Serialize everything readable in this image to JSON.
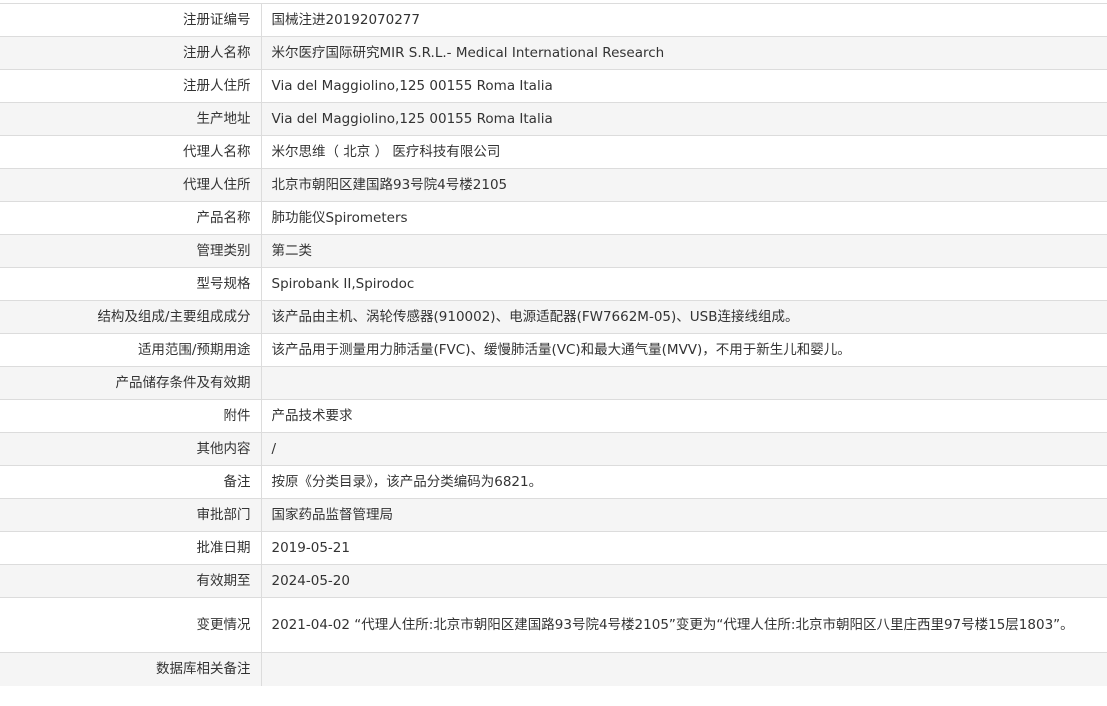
{
  "rows": [
    {
      "label": "注册证编号",
      "value": "国械注进20192070277"
    },
    {
      "label": "注册人名称",
      "value": "米尔医疗国际研究MIR S.R.L.- Medical International Research"
    },
    {
      "label": "注册人住所",
      "value": "Via del Maggiolino,125 00155 Roma Italia"
    },
    {
      "label": "生产地址",
      "value": "Via del Maggiolino,125 00155 Roma Italia"
    },
    {
      "label": "代理人名称",
      "value": "米尔思维（ 北京 ） 医疗科技有限公司"
    },
    {
      "label": "代理人住所",
      "value": "北京市朝阳区建国路93号院4号楼2105"
    },
    {
      "label": "产品名称",
      "value": "肺功能仪Spirometers"
    },
    {
      "label": "管理类别",
      "value": "第二类"
    },
    {
      "label": "型号规格",
      "value": "Spirobank II,Spirodoc"
    },
    {
      "label": "结构及组成/主要组成成分",
      "value": "该产品由主机、涡轮传感器(910002)、电源适配器(FW7662M-05)、USB连接线组成。"
    },
    {
      "label": "适用范围/预期用途",
      "value": "该产品用于测量用力肺活量(FVC)、缓慢肺活量(VC)和最大通气量(MVV)，不用于新生儿和婴儿。"
    },
    {
      "label": "产品储存条件及有效期",
      "value": ""
    },
    {
      "label": "附件",
      "value": "产品技术要求"
    },
    {
      "label": "其他内容",
      "value": "/"
    },
    {
      "label": "备注",
      "value": "按原《分类目录》，该产品分类编码为6821。"
    },
    {
      "label": "审批部门",
      "value": "国家药品监督管理局"
    },
    {
      "label": "批准日期",
      "value": "2019-05-21"
    },
    {
      "label": "有效期至",
      "value": "2024-05-20"
    },
    {
      "label": "变更情况",
      "value": "2021-04-02 “代理人住所:北京市朝阳区建国路93号院4号楼2105”变更为“代理人住所:北京市朝阳区八里庄西里97号楼15层1803”。"
    },
    {
      "label": "数据库相关备注",
      "value": ""
    }
  ]
}
